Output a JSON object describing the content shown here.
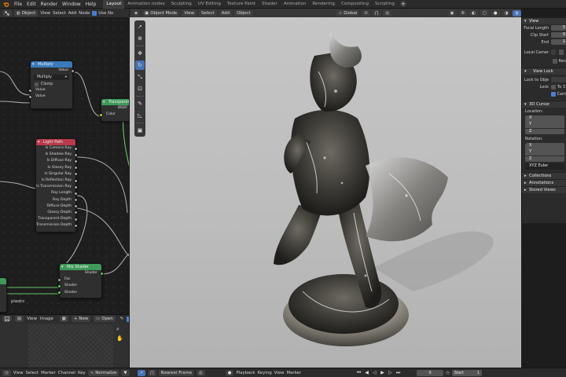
{
  "menubar": {
    "menus": [
      "File",
      "Edit",
      "Render",
      "Window",
      "Help"
    ],
    "workspaces": [
      "Layout",
      "Animation nodes",
      "Sculpting",
      "UV Editing",
      "Texture Paint",
      "Shader",
      "Animation",
      "Rendering",
      "Compositing",
      "Scripting"
    ],
    "active_workspace": "Layout",
    "add_label": "+"
  },
  "node_editor": {
    "header": {
      "object_dropdown": "Object",
      "menus": [
        "View",
        "Select",
        "Add",
        "Node"
      ],
      "use_nodes": "Use No"
    },
    "nodes": {
      "multiply": {
        "title": "Multiply",
        "out_value": "Value",
        "operation": "Multiply",
        "clamp": "Clamp",
        "in_value1": "Value",
        "in_value2": "Value"
      },
      "transparent": {
        "title": "Transparent",
        "out": "BSDF",
        "in_color": "Color"
      },
      "light_path": {
        "title": "Light Path",
        "outputs": [
          "Is Camera Ray",
          "Is Shadow Ray",
          "Is Diffuse Ray",
          "Is Glossy Ray",
          "Is Singular Ray",
          "Is Reflection Ray",
          "Is Transmission Ray",
          "Ray Length",
          "Ray Depth",
          "Diffuse Depth",
          "Glossy Depth",
          "Transparent Depth",
          "Transmission Depth"
        ]
      },
      "mix_shader": {
        "title": "Mix Shader",
        "out": "Shader",
        "in_fac": "Fac",
        "in_shader1": "Shader",
        "in_shader2": "Shader"
      },
      "plastic_label": "plastic"
    }
  },
  "image_editor": {
    "menus": [
      "View",
      "Image"
    ],
    "new_label": "New",
    "open_label": "Open"
  },
  "viewport": {
    "header": {
      "mode": "Object Mode",
      "menus": [
        "View",
        "Select",
        "Add",
        "Object"
      ],
      "transform_orientation": "Global"
    }
  },
  "npanel": {
    "view_section": "View",
    "focal_length": "Focal Length",
    "focal_length_value": "5",
    "clip_start": "Clip Start",
    "clip_start_value": "0",
    "clip_end": "End",
    "clip_end_value": "1",
    "local_camera": "Local Camer",
    "render_region": "Ren",
    "view_lock": "View Lock",
    "lock_to_object": "Lock to Obje",
    "lock": "Lock",
    "lock_to_3d": "To 3",
    "lock_camera": "Cam",
    "cursor_section": "3D Cursor",
    "location": "Location:",
    "rotation": "Rotation:",
    "axes": [
      "X",
      "Y",
      "Z"
    ],
    "rotation_mode": "XYZ Euler",
    "collections": "Collections",
    "annotations": "Annotations",
    "stored_views": "Stored Views"
  },
  "timeline": {
    "menus": [
      "View",
      "Select",
      "Marker",
      "Channel",
      "Key"
    ],
    "normalize": "Normalize",
    "interpolation": "Nearest Frame",
    "playback": "Playback",
    "keying": "Keying",
    "view_label": "View",
    "marker_label": "Marker",
    "current_frame": "0",
    "start_label": "Start",
    "start_value": "1"
  }
}
